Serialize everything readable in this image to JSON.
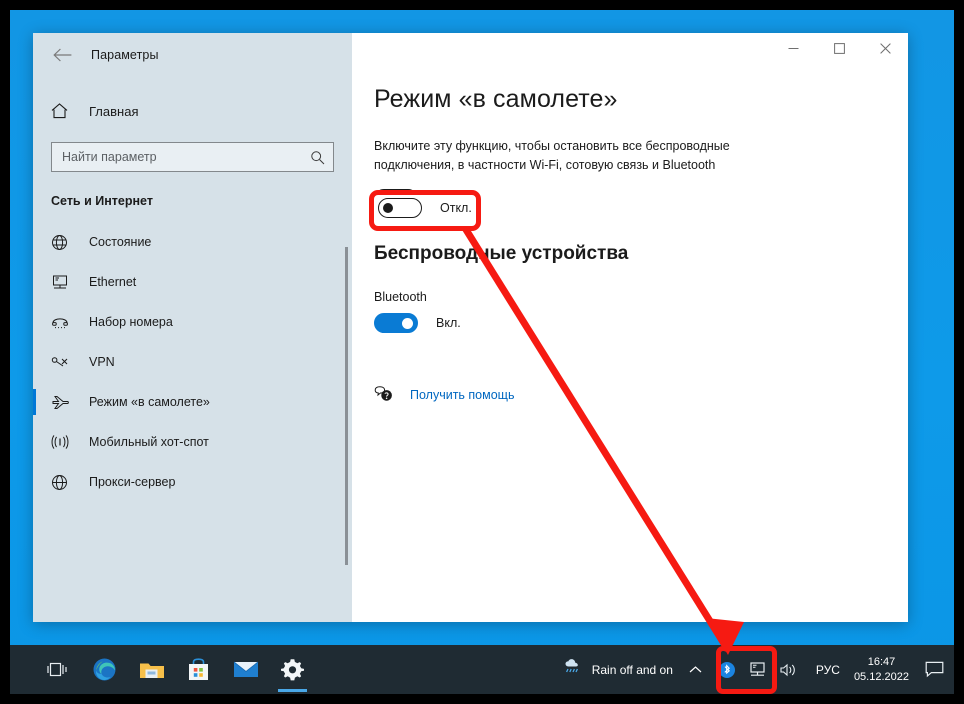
{
  "window": {
    "app_title": "Параметры",
    "back_icon": "back-arrow-icon",
    "controls": {
      "minimize": "minimize-icon",
      "maximize": "maximize-icon",
      "close": "close-icon"
    }
  },
  "sidebar": {
    "home_label": "Главная",
    "home_icon": "home-icon",
    "search": {
      "placeholder": "Найти параметр",
      "value": "",
      "icon": "search-icon"
    },
    "category": "Сеть и Интернет",
    "items": [
      {
        "label": "Состояние",
        "icon": "globe-status-icon",
        "active": false
      },
      {
        "label": "Ethernet",
        "icon": "ethernet-icon",
        "active": false
      },
      {
        "label": "Набор номера",
        "icon": "dial-up-icon",
        "active": false
      },
      {
        "label": "VPN",
        "icon": "vpn-icon",
        "active": false
      },
      {
        "label": "Режим «в самолете»",
        "icon": "airplane-icon",
        "active": true
      },
      {
        "label": "Мобильный хот-спот",
        "icon": "hotspot-icon",
        "active": false
      },
      {
        "label": "Прокси-сервер",
        "icon": "proxy-globe-icon",
        "active": false
      }
    ]
  },
  "main": {
    "heading": "Режим «в самолете»",
    "description": "Включите эту функцию, чтобы остановить все беспроводные подключения, в частности Wi-Fi, сотовую связь и Bluetooth",
    "airplane_toggle": {
      "state": "off",
      "label": "Откл."
    },
    "wireless_heading": "Беспроводные устройства",
    "bluetooth_label": "Bluetooth",
    "bluetooth_toggle": {
      "state": "on",
      "label": "Вкл."
    },
    "help": {
      "label": "Получить помощь",
      "icon": "help-bubble-icon"
    }
  },
  "taskbar": {
    "buttons": [
      {
        "name": "task-view",
        "icon": "task-view-icon",
        "active": false
      },
      {
        "name": "edge",
        "icon": "edge-icon",
        "active": false
      },
      {
        "name": "file-explorer",
        "icon": "folder-icon",
        "active": false
      },
      {
        "name": "microsoft-store",
        "icon": "store-icon",
        "active": false
      },
      {
        "name": "mail",
        "icon": "mail-icon",
        "active": false
      },
      {
        "name": "settings",
        "icon": "gear-icon",
        "active": true
      }
    ],
    "weather": {
      "text": "Rain off and on",
      "icon": "rain-icon"
    },
    "tray": {
      "chevron_icon": "chevron-up-icon",
      "icons": [
        {
          "name": "bluetooth-icon"
        },
        {
          "name": "network-icon"
        },
        {
          "name": "volume-icon"
        }
      ]
    },
    "language": "РУС",
    "clock": {
      "time": "16:47",
      "date": "05.12.2022"
    },
    "notifications_icon": "notification-icon"
  },
  "annotations": {
    "accent_color": "#f61a12",
    "box_airplane_toggle": "highlight-airplane-toggle",
    "box_tray_icons": "highlight-tray-bluetooth-network",
    "arrow": "arrow-from-toggle-to-tray"
  }
}
